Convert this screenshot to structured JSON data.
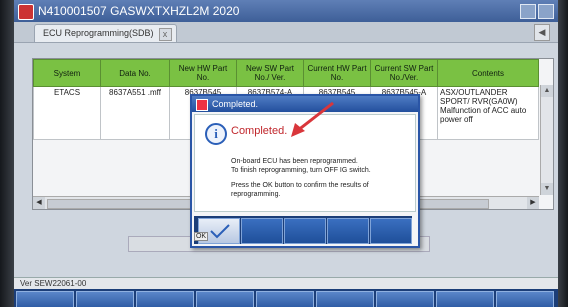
{
  "window": {
    "title": "N410001507  GASWXTXHZL2M 2020"
  },
  "tabs": [
    {
      "label": "ECU Reprogramming(SDB)",
      "close": "x"
    }
  ],
  "table": {
    "headers": [
      "System",
      "Data No.",
      "New HW Part No.",
      "New SW Part No./ Ver.",
      "Current HW Part No.",
      "Current SW Part No./Ver.",
      "Contents"
    ],
    "rows": [
      [
        "ETACS",
        "8637A551 .mff",
        "8637B545",
        "8637B574-A",
        "8637B545",
        "8637B545-A",
        "ASX/OUTLANDER SPORT/ RVR(GA0W)  Malfunction of ACC auto power off"
      ]
    ]
  },
  "dialog": {
    "title": "Completed.",
    "heading": "Completed.",
    "line1": "On-board ECU has been reprogrammed.",
    "line2": "To finish reprogramming, turn OFF IG switch.",
    "line3": "Press the OK button to confirm the results of reprogramming.",
    "ok_label": "OK"
  },
  "status": {
    "version": "Ver SEW22061-00"
  },
  "colors": {
    "header_green": "#7ac143",
    "completed_red": "#c0262b",
    "title_blue": "#3e5f98"
  },
  "icons": {
    "info": "info-icon",
    "checkmark": "checkmark-icon"
  }
}
